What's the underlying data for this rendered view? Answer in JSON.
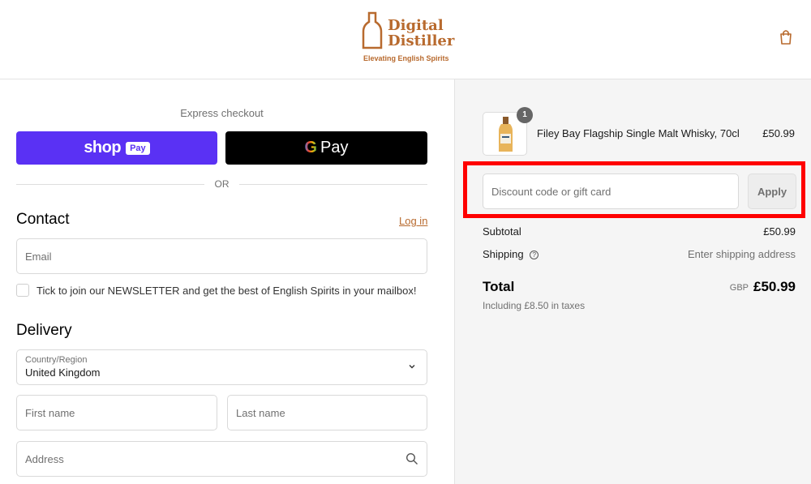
{
  "header": {
    "brand_line1": "Digital",
    "brand_line2": "Distiller",
    "tagline": "Elevating English Spirits"
  },
  "express": {
    "label": "Express checkout",
    "shop_pay": {
      "word": "shop",
      "chip": "Pay"
    },
    "google_pay": {
      "g": "G",
      "word": "Pay"
    },
    "or": "OR"
  },
  "contact": {
    "title": "Contact",
    "login": "Log in",
    "email_placeholder": "Email",
    "newsletter": "Tick to join our NEWSLETTER and get the best of English Spirits in your mailbox!"
  },
  "delivery": {
    "title": "Delivery",
    "country_label": "Country/Region",
    "country_value": "United Kingdom",
    "first_name_placeholder": "First name",
    "last_name_placeholder": "Last name",
    "address_placeholder": "Address"
  },
  "summary": {
    "product": {
      "name": "Filey Bay Flagship Single Malt Whisky, 70cl",
      "price": "£50.99",
      "quantity": "1"
    },
    "discount_placeholder": "Discount code or gift card",
    "apply": "Apply",
    "subtotal_label": "Subtotal",
    "subtotal_value": "£50.99",
    "shipping_label": "Shipping",
    "shipping_value": "Enter shipping address",
    "total_label": "Total",
    "currency": "GBP",
    "total_value": "£50.99",
    "taxes": "Including £8.50 in taxes"
  },
  "colors": {
    "accent": "#b86a2e",
    "shop_pay": "#5a31f4",
    "highlight": "#ff0000"
  }
}
